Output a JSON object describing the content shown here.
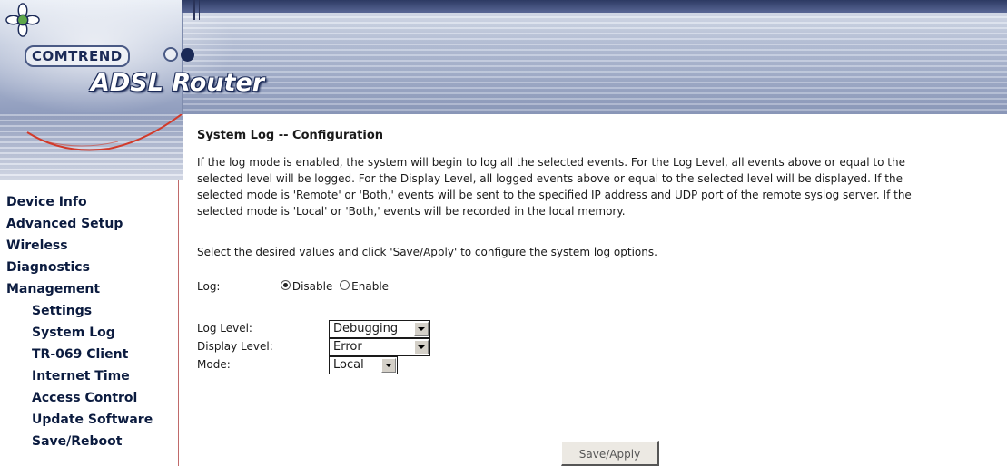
{
  "header": {
    "brand": "COMTREND",
    "product": "ADSL Router"
  },
  "sidebar": {
    "items": [
      {
        "label": "Device Info"
      },
      {
        "label": "Advanced Setup"
      },
      {
        "label": "Wireless"
      },
      {
        "label": "Diagnostics"
      },
      {
        "label": "Management"
      }
    ],
    "subitems": [
      {
        "label": "Settings"
      },
      {
        "label": "System Log"
      },
      {
        "label": "TR-069 Client"
      },
      {
        "label": "Internet Time"
      },
      {
        "label": "Access Control"
      },
      {
        "label": "Update Software"
      },
      {
        "label": "Save/Reboot"
      }
    ]
  },
  "main": {
    "title": "System Log -- Configuration",
    "description_lines": [
      "If the log mode is enabled, the system will begin to log all the selected events. For the Log Level, all events above or equal to the",
      "selected level will be logged. For the Display Level, all logged events above or equal to the selected level will be displayed. If the",
      "selected mode is 'Remote' or 'Both,' events will be sent to the specified IP address and UDP port of the remote syslog server. If the",
      "selected mode is 'Local' or 'Both,' events will be recorded in the local memory."
    ],
    "instruction": "Select the desired values and click 'Save/Apply' to configure the system log options.",
    "log": {
      "label": "Log:",
      "option_disable": "Disable",
      "option_enable": "Enable",
      "selected": "Disable"
    },
    "log_level": {
      "label": "Log Level:",
      "value": "Debugging"
    },
    "display_level": {
      "label": "Display Level:",
      "value": "Error"
    },
    "mode": {
      "label": "Mode:",
      "value": "Local"
    },
    "save_button": "Save/Apply"
  },
  "colors": {
    "nav_text": "#0b1b3f",
    "sidebar_border": "#c06a6a",
    "banner_dark": "#1b2a57"
  }
}
